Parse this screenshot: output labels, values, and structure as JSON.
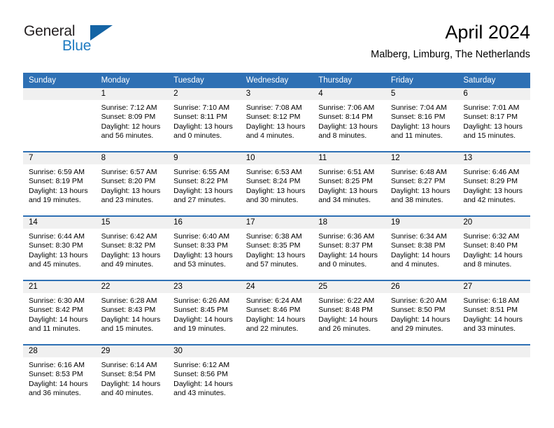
{
  "brand": {
    "name_top": "General",
    "name_bottom": "Blue",
    "triangle_icon": "triangle-icon",
    "color_dark": "#231f20",
    "color_blue": "#1f7bc1"
  },
  "header": {
    "month_title": "April 2024",
    "location": "Malberg, Limburg, The Netherlands"
  },
  "theme": {
    "header_blue": "#2e70b4",
    "date_band_gray": "#f0f0f0",
    "separator_blue": "#2e70b4",
    "text_black": "#000000"
  },
  "calendar": {
    "weekday_headers": [
      "Sunday",
      "Monday",
      "Tuesday",
      "Wednesday",
      "Thursday",
      "Friday",
      "Saturday"
    ],
    "weeks": [
      [
        {
          "day": "",
          "empty": true,
          "sunrise": "",
          "sunset": "",
          "daylight_1": "",
          "daylight_2": ""
        },
        {
          "day": "1",
          "empty": false,
          "sunrise": "Sunrise: 7:12 AM",
          "sunset": "Sunset: 8:09 PM",
          "daylight_1": "Daylight: 12 hours",
          "daylight_2": "and 56 minutes."
        },
        {
          "day": "2",
          "empty": false,
          "sunrise": "Sunrise: 7:10 AM",
          "sunset": "Sunset: 8:11 PM",
          "daylight_1": "Daylight: 13 hours",
          "daylight_2": "and 0 minutes."
        },
        {
          "day": "3",
          "empty": false,
          "sunrise": "Sunrise: 7:08 AM",
          "sunset": "Sunset: 8:12 PM",
          "daylight_1": "Daylight: 13 hours",
          "daylight_2": "and 4 minutes."
        },
        {
          "day": "4",
          "empty": false,
          "sunrise": "Sunrise: 7:06 AM",
          "sunset": "Sunset: 8:14 PM",
          "daylight_1": "Daylight: 13 hours",
          "daylight_2": "and 8 minutes."
        },
        {
          "day": "5",
          "empty": false,
          "sunrise": "Sunrise: 7:04 AM",
          "sunset": "Sunset: 8:16 PM",
          "daylight_1": "Daylight: 13 hours",
          "daylight_2": "and 11 minutes."
        },
        {
          "day": "6",
          "empty": false,
          "sunrise": "Sunrise: 7:01 AM",
          "sunset": "Sunset: 8:17 PM",
          "daylight_1": "Daylight: 13 hours",
          "daylight_2": "and 15 minutes."
        }
      ],
      [
        {
          "day": "7",
          "empty": false,
          "sunrise": "Sunrise: 6:59 AM",
          "sunset": "Sunset: 8:19 PM",
          "daylight_1": "Daylight: 13 hours",
          "daylight_2": "and 19 minutes."
        },
        {
          "day": "8",
          "empty": false,
          "sunrise": "Sunrise: 6:57 AM",
          "sunset": "Sunset: 8:20 PM",
          "daylight_1": "Daylight: 13 hours",
          "daylight_2": "and 23 minutes."
        },
        {
          "day": "9",
          "empty": false,
          "sunrise": "Sunrise: 6:55 AM",
          "sunset": "Sunset: 8:22 PM",
          "daylight_1": "Daylight: 13 hours",
          "daylight_2": "and 27 minutes."
        },
        {
          "day": "10",
          "empty": false,
          "sunrise": "Sunrise: 6:53 AM",
          "sunset": "Sunset: 8:24 PM",
          "daylight_1": "Daylight: 13 hours",
          "daylight_2": "and 30 minutes."
        },
        {
          "day": "11",
          "empty": false,
          "sunrise": "Sunrise: 6:51 AM",
          "sunset": "Sunset: 8:25 PM",
          "daylight_1": "Daylight: 13 hours",
          "daylight_2": "and 34 minutes."
        },
        {
          "day": "12",
          "empty": false,
          "sunrise": "Sunrise: 6:48 AM",
          "sunset": "Sunset: 8:27 PM",
          "daylight_1": "Daylight: 13 hours",
          "daylight_2": "and 38 minutes."
        },
        {
          "day": "13",
          "empty": false,
          "sunrise": "Sunrise: 6:46 AM",
          "sunset": "Sunset: 8:29 PM",
          "daylight_1": "Daylight: 13 hours",
          "daylight_2": "and 42 minutes."
        }
      ],
      [
        {
          "day": "14",
          "empty": false,
          "sunrise": "Sunrise: 6:44 AM",
          "sunset": "Sunset: 8:30 PM",
          "daylight_1": "Daylight: 13 hours",
          "daylight_2": "and 45 minutes."
        },
        {
          "day": "15",
          "empty": false,
          "sunrise": "Sunrise: 6:42 AM",
          "sunset": "Sunset: 8:32 PM",
          "daylight_1": "Daylight: 13 hours",
          "daylight_2": "and 49 minutes."
        },
        {
          "day": "16",
          "empty": false,
          "sunrise": "Sunrise: 6:40 AM",
          "sunset": "Sunset: 8:33 PM",
          "daylight_1": "Daylight: 13 hours",
          "daylight_2": "and 53 minutes."
        },
        {
          "day": "17",
          "empty": false,
          "sunrise": "Sunrise: 6:38 AM",
          "sunset": "Sunset: 8:35 PM",
          "daylight_1": "Daylight: 13 hours",
          "daylight_2": "and 57 minutes."
        },
        {
          "day": "18",
          "empty": false,
          "sunrise": "Sunrise: 6:36 AM",
          "sunset": "Sunset: 8:37 PM",
          "daylight_1": "Daylight: 14 hours",
          "daylight_2": "and 0 minutes."
        },
        {
          "day": "19",
          "empty": false,
          "sunrise": "Sunrise: 6:34 AM",
          "sunset": "Sunset: 8:38 PM",
          "daylight_1": "Daylight: 14 hours",
          "daylight_2": "and 4 minutes."
        },
        {
          "day": "20",
          "empty": false,
          "sunrise": "Sunrise: 6:32 AM",
          "sunset": "Sunset: 8:40 PM",
          "daylight_1": "Daylight: 14 hours",
          "daylight_2": "and 8 minutes."
        }
      ],
      [
        {
          "day": "21",
          "empty": false,
          "sunrise": "Sunrise: 6:30 AM",
          "sunset": "Sunset: 8:42 PM",
          "daylight_1": "Daylight: 14 hours",
          "daylight_2": "and 11 minutes."
        },
        {
          "day": "22",
          "empty": false,
          "sunrise": "Sunrise: 6:28 AM",
          "sunset": "Sunset: 8:43 PM",
          "daylight_1": "Daylight: 14 hours",
          "daylight_2": "and 15 minutes."
        },
        {
          "day": "23",
          "empty": false,
          "sunrise": "Sunrise: 6:26 AM",
          "sunset": "Sunset: 8:45 PM",
          "daylight_1": "Daylight: 14 hours",
          "daylight_2": "and 19 minutes."
        },
        {
          "day": "24",
          "empty": false,
          "sunrise": "Sunrise: 6:24 AM",
          "sunset": "Sunset: 8:46 PM",
          "daylight_1": "Daylight: 14 hours",
          "daylight_2": "and 22 minutes."
        },
        {
          "day": "25",
          "empty": false,
          "sunrise": "Sunrise: 6:22 AM",
          "sunset": "Sunset: 8:48 PM",
          "daylight_1": "Daylight: 14 hours",
          "daylight_2": "and 26 minutes."
        },
        {
          "day": "26",
          "empty": false,
          "sunrise": "Sunrise: 6:20 AM",
          "sunset": "Sunset: 8:50 PM",
          "daylight_1": "Daylight: 14 hours",
          "daylight_2": "and 29 minutes."
        },
        {
          "day": "27",
          "empty": false,
          "sunrise": "Sunrise: 6:18 AM",
          "sunset": "Sunset: 8:51 PM",
          "daylight_1": "Daylight: 14 hours",
          "daylight_2": "and 33 minutes."
        }
      ],
      [
        {
          "day": "28",
          "empty": false,
          "sunrise": "Sunrise: 6:16 AM",
          "sunset": "Sunset: 8:53 PM",
          "daylight_1": "Daylight: 14 hours",
          "daylight_2": "and 36 minutes."
        },
        {
          "day": "29",
          "empty": false,
          "sunrise": "Sunrise: 6:14 AM",
          "sunset": "Sunset: 8:54 PM",
          "daylight_1": "Daylight: 14 hours",
          "daylight_2": "and 40 minutes."
        },
        {
          "day": "30",
          "empty": false,
          "sunrise": "Sunrise: 6:12 AM",
          "sunset": "Sunset: 8:56 PM",
          "daylight_1": "Daylight: 14 hours",
          "daylight_2": "and 43 minutes."
        },
        {
          "day": "",
          "empty": true,
          "sunrise": "",
          "sunset": "",
          "daylight_1": "",
          "daylight_2": ""
        },
        {
          "day": "",
          "empty": true,
          "sunrise": "",
          "sunset": "",
          "daylight_1": "",
          "daylight_2": ""
        },
        {
          "day": "",
          "empty": true,
          "sunrise": "",
          "sunset": "",
          "daylight_1": "",
          "daylight_2": ""
        },
        {
          "day": "",
          "empty": true,
          "sunrise": "",
          "sunset": "",
          "daylight_1": "",
          "daylight_2": ""
        }
      ]
    ]
  }
}
